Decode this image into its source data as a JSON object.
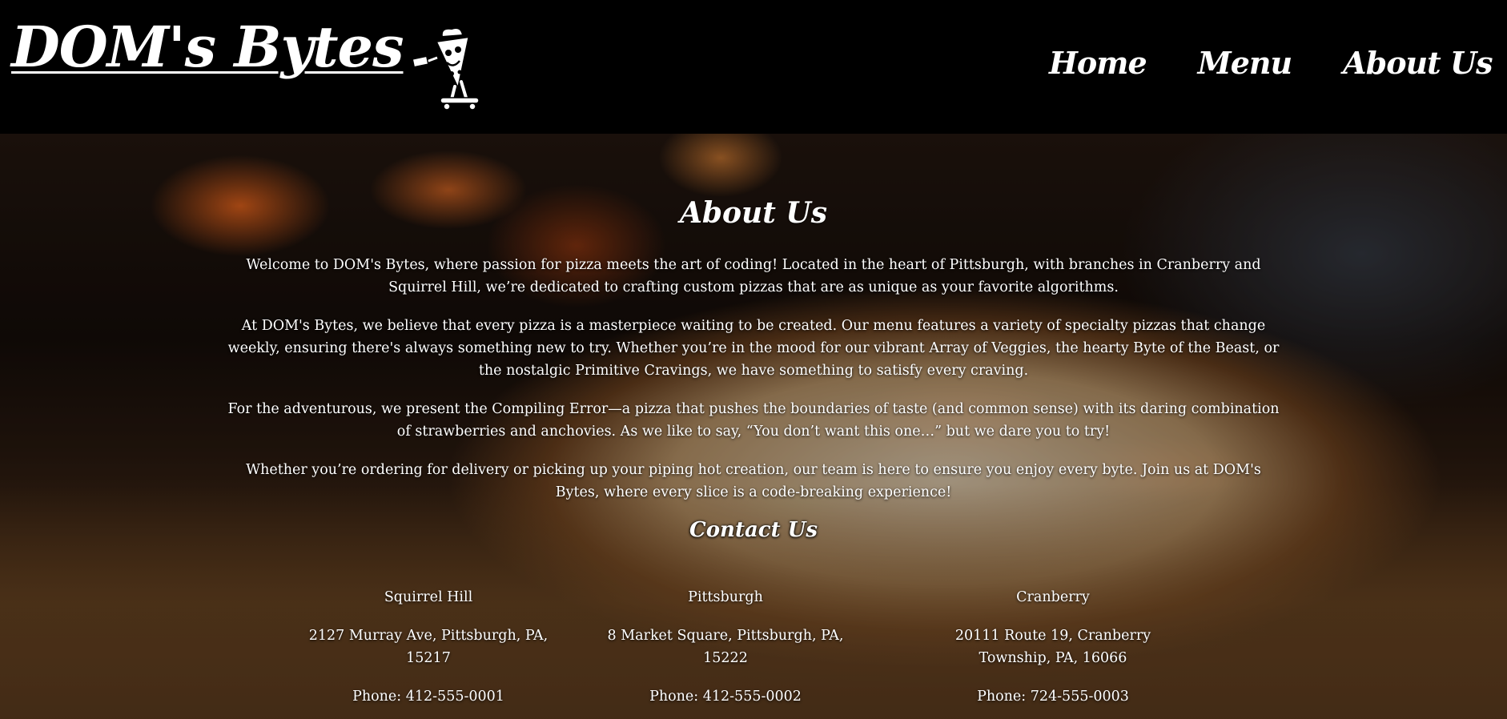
{
  "header": {
    "logo_text": "DOM's Bytes",
    "mascot_icon": "pizza-skateboard-mascot-icon",
    "nav": [
      {
        "label": "Home"
      },
      {
        "label": "Menu"
      },
      {
        "label": "About Us"
      }
    ]
  },
  "about": {
    "title": "About Us",
    "paragraphs": [
      "Welcome to DOM's Bytes, where passion for pizza meets the art of coding! Located in the heart of Pittsburgh, with branches in Cranberry and Squirrel Hill, we’re dedicated to crafting custom pizzas that are as unique as your favorite algorithms.",
      "At DOM's Bytes, we believe that every pizza is a masterpiece waiting to be created. Our menu features a variety of specialty pizzas that change weekly, ensuring there's always something new to try. Whether you’re in the mood for our vibrant Array of Veggies, the hearty Byte of the Beast, or the nostalgic Primitive Cravings, we have something to satisfy every craving.",
      "For the adventurous, we present the Compiling Error—a pizza that pushes the boundaries of taste (and common sense) with its daring combination of strawberries and anchovies. As we like to say, “You don’t want this one…” but we dare you to try!",
      "Whether you’re ordering for delivery or picking up your piping hot creation, our team is here to ensure you enjoy every byte. Join us at DOM's Bytes, where every slice is a code-breaking experience!"
    ]
  },
  "contact": {
    "title": "Contact Us",
    "locations": [
      {
        "name": "Squirrel Hill",
        "address": "2127 Murray Ave, Pittsburgh, PA, 15217",
        "phone": "Phone: 412-555-0001"
      },
      {
        "name": "Pittsburgh",
        "address": "8 Market Square, Pittsburgh, PA, 15222",
        "phone": "Phone: 412-555-0002"
      },
      {
        "name": "Cranberry",
        "address": "20111 Route 19, Cranberry Township, PA, 16066",
        "phone": "Phone: 724-555-0003"
      }
    ]
  },
  "colors": {
    "header_bg": "#000000",
    "text": "#ffffff"
  }
}
